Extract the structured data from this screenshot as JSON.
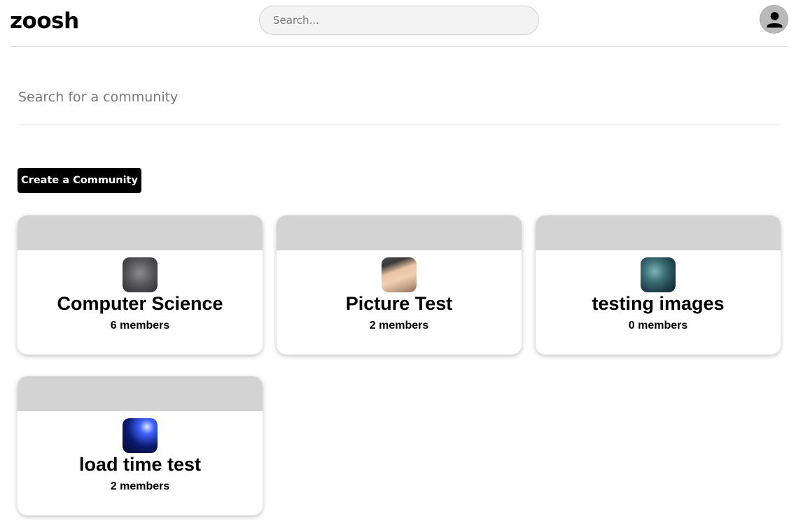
{
  "header": {
    "logo": "zoosh",
    "search_placeholder": "Search..."
  },
  "community_search": {
    "placeholder": "Search for a community"
  },
  "create_button": "Create a Community",
  "communities": [
    {
      "name": "Computer Science",
      "members": "6 members"
    },
    {
      "name": "Picture Test",
      "members": "2 members"
    },
    {
      "name": "testing images",
      "members": "0 members"
    },
    {
      "name": "load time test",
      "members": "2 members"
    }
  ]
}
